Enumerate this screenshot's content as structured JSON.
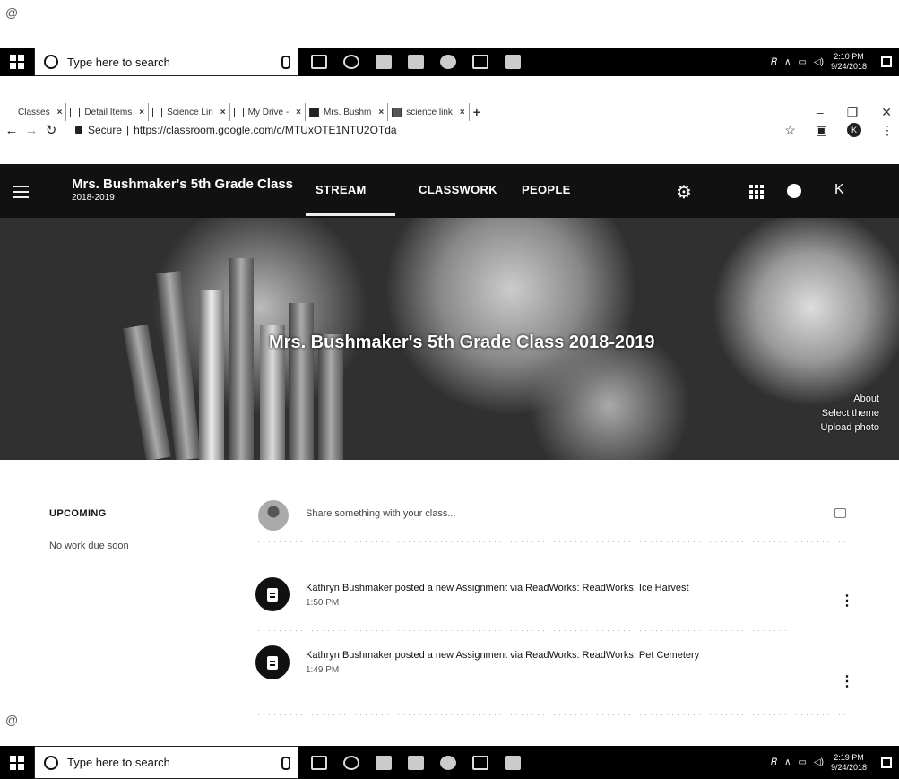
{
  "taskbar_top": {
    "search_placeholder": "Type here to search",
    "time": "2:10 PM",
    "date": "9/24/2018"
  },
  "taskbar_bottom": {
    "search_placeholder": "Type here to search",
    "time": "2:19 PM",
    "date": "9/24/2018"
  },
  "browser": {
    "tabs": [
      {
        "label": "Classes"
      },
      {
        "label": "Detail Items"
      },
      {
        "label": "Science Lin"
      },
      {
        "label": "My Drive -"
      },
      {
        "label": "Mrs. Bushm"
      },
      {
        "label": "science link"
      }
    ],
    "new_tab": "+",
    "secure_label": "Secure",
    "url": "https://classroom.google.com/c/MTUxOTE1NTU2OTda",
    "profile_initial": "K"
  },
  "classroom": {
    "class_name": "Mrs. Bushmaker's 5th Grade Class",
    "class_year": "2018-2019",
    "nav_tabs": [
      "STREAM",
      "CLASSWORK",
      "PEOPLE"
    ],
    "account_initial": "K",
    "banner_title": "Mrs. Bushmaker's 5th Grade Class  2018-2019",
    "banner_links": [
      "About",
      "Select theme",
      "Upload photo"
    ]
  },
  "upcoming": {
    "heading": "UPCOMING",
    "text": "No work due soon"
  },
  "share": {
    "placeholder": "Share something with your class..."
  },
  "posts": [
    {
      "title": "Kathryn Bushmaker posted a new Assignment via ReadWorks: ReadWorks: Ice Harvest",
      "time": "1:50 PM"
    },
    {
      "title": "Kathryn Bushmaker posted a new Assignment via ReadWorks: ReadWorks: Pet Cemetery",
      "time": "1:49 PM"
    }
  ]
}
